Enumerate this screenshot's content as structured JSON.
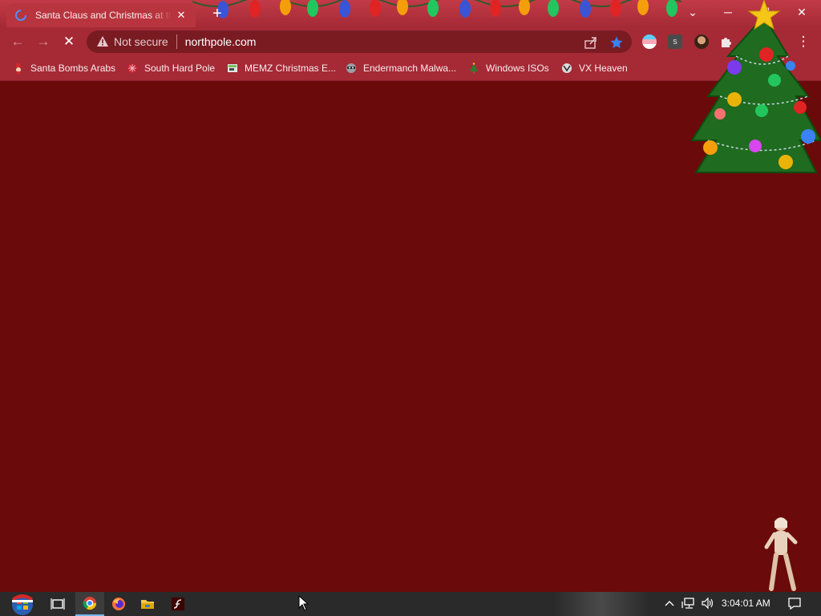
{
  "tab": {
    "title": "Santa Claus and Christmas at the North Pole",
    "close_glyph": "✕"
  },
  "window": {
    "newtab_glyph": "+",
    "menu_glyph": "⌄",
    "minimize_glyph": "─",
    "maximize_glyph": "☐",
    "close_glyph": "✕"
  },
  "toolbar": {
    "back_glyph": "←",
    "forward_glyph": "→",
    "stop_glyph": "✕",
    "security_label": "Not secure",
    "url": "northpole.com",
    "menu_glyph": "⋮"
  },
  "bookmarks": [
    {
      "label": "Santa Bombs Arabs",
      "icon": "santa-icon"
    },
    {
      "label": "South Hard Pole",
      "icon": "snowflake-icon"
    },
    {
      "label": "MEMZ Christmas E...",
      "icon": "memz-icon"
    },
    {
      "label": "Endermanch Malwa...",
      "icon": "raccoon-icon"
    },
    {
      "label": "Windows ISOs",
      "icon": "tree-icon"
    },
    {
      "label": "VX Heaven",
      "icon": "vx-icon"
    }
  ],
  "taskbar": {
    "clock": "3:04:01 AM",
    "tray_chevron": "^",
    "tray_volume": "🔊"
  },
  "colors": {
    "page_bg": "#6b0a0a",
    "chrome_bg": "#a52a36",
    "omnibox_bg": "#7a1b22",
    "bookmark_star": "#3b82f6"
  }
}
